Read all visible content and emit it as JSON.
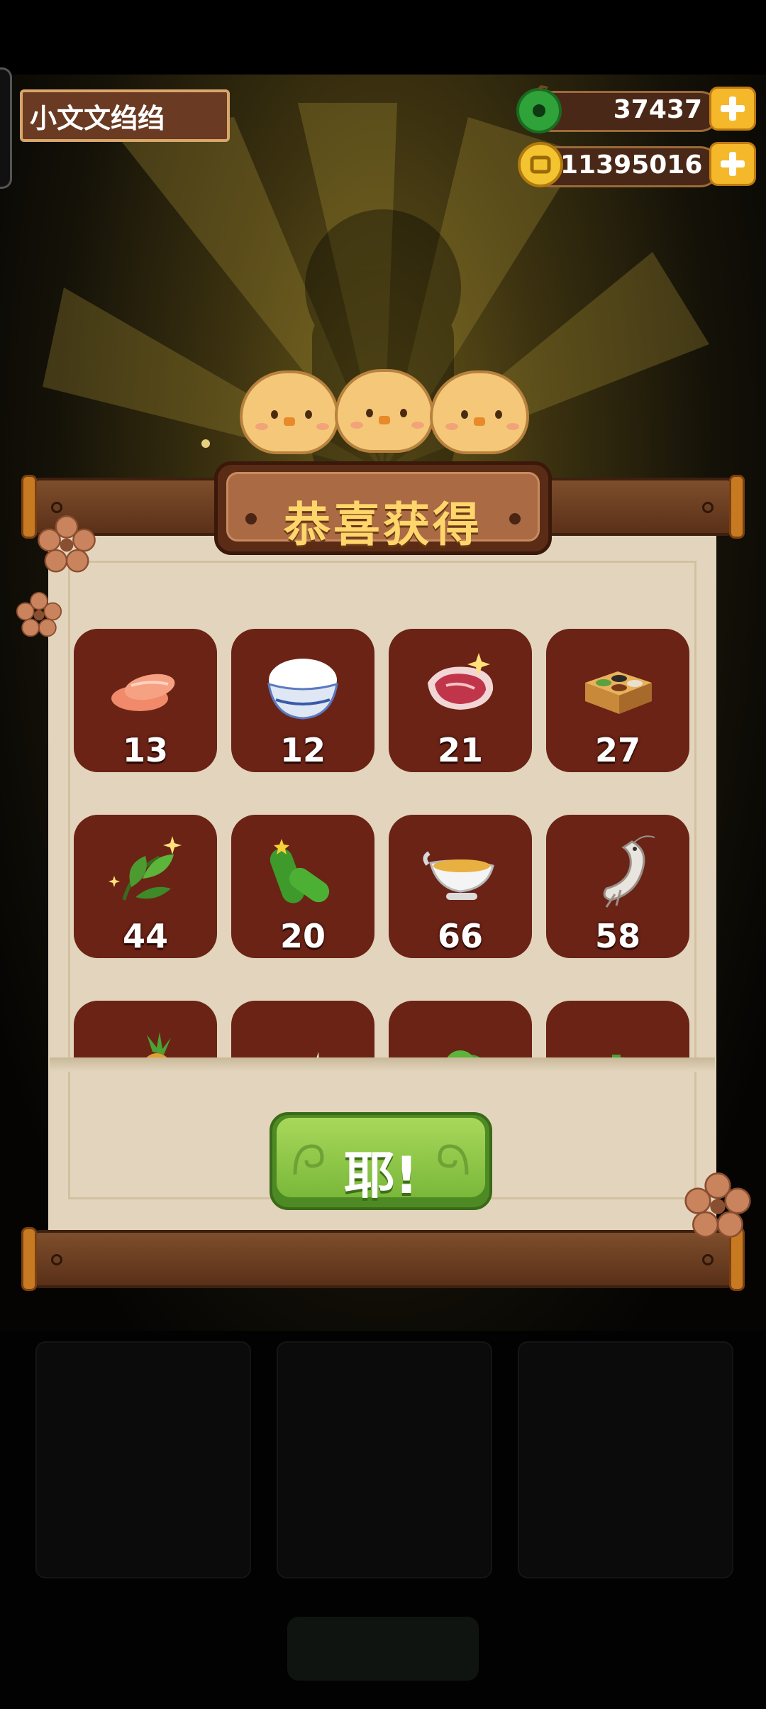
{
  "player": {
    "name": "小文文绉绉"
  },
  "currencies": {
    "jade": {
      "icon": "green-jade-icon",
      "value": "37437"
    },
    "coins": {
      "icon": "gold-coin-icon",
      "value": "11395016"
    }
  },
  "reward_popup": {
    "title": "恭喜获得",
    "confirm_label": "耶!",
    "items": [
      {
        "icon": "salmon-icon",
        "count": "13"
      },
      {
        "icon": "rice-bowl-icon",
        "count": "12"
      },
      {
        "icon": "meat-icon",
        "count": "21"
      },
      {
        "icon": "spice-box-icon",
        "count": "27"
      },
      {
        "icon": "tea-leaf-icon",
        "count": "44"
      },
      {
        "icon": "cucumber-icon",
        "count": "20"
      },
      {
        "icon": "sauce-boat-icon",
        "count": "66"
      },
      {
        "icon": "shrimp-icon",
        "count": "58"
      },
      {
        "icon": "pineapple-icon",
        "count": ""
      },
      {
        "icon": "bamboo-shoot-icon",
        "count": ""
      },
      {
        "icon": "cabbage-icon",
        "count": ""
      },
      {
        "icon": "celery-icon",
        "count": ""
      }
    ]
  },
  "colors": {
    "item_tile": "#6b2316",
    "paper": "#e3d5bd",
    "title_text": "#ffd66b",
    "button": "#8cc44a"
  }
}
